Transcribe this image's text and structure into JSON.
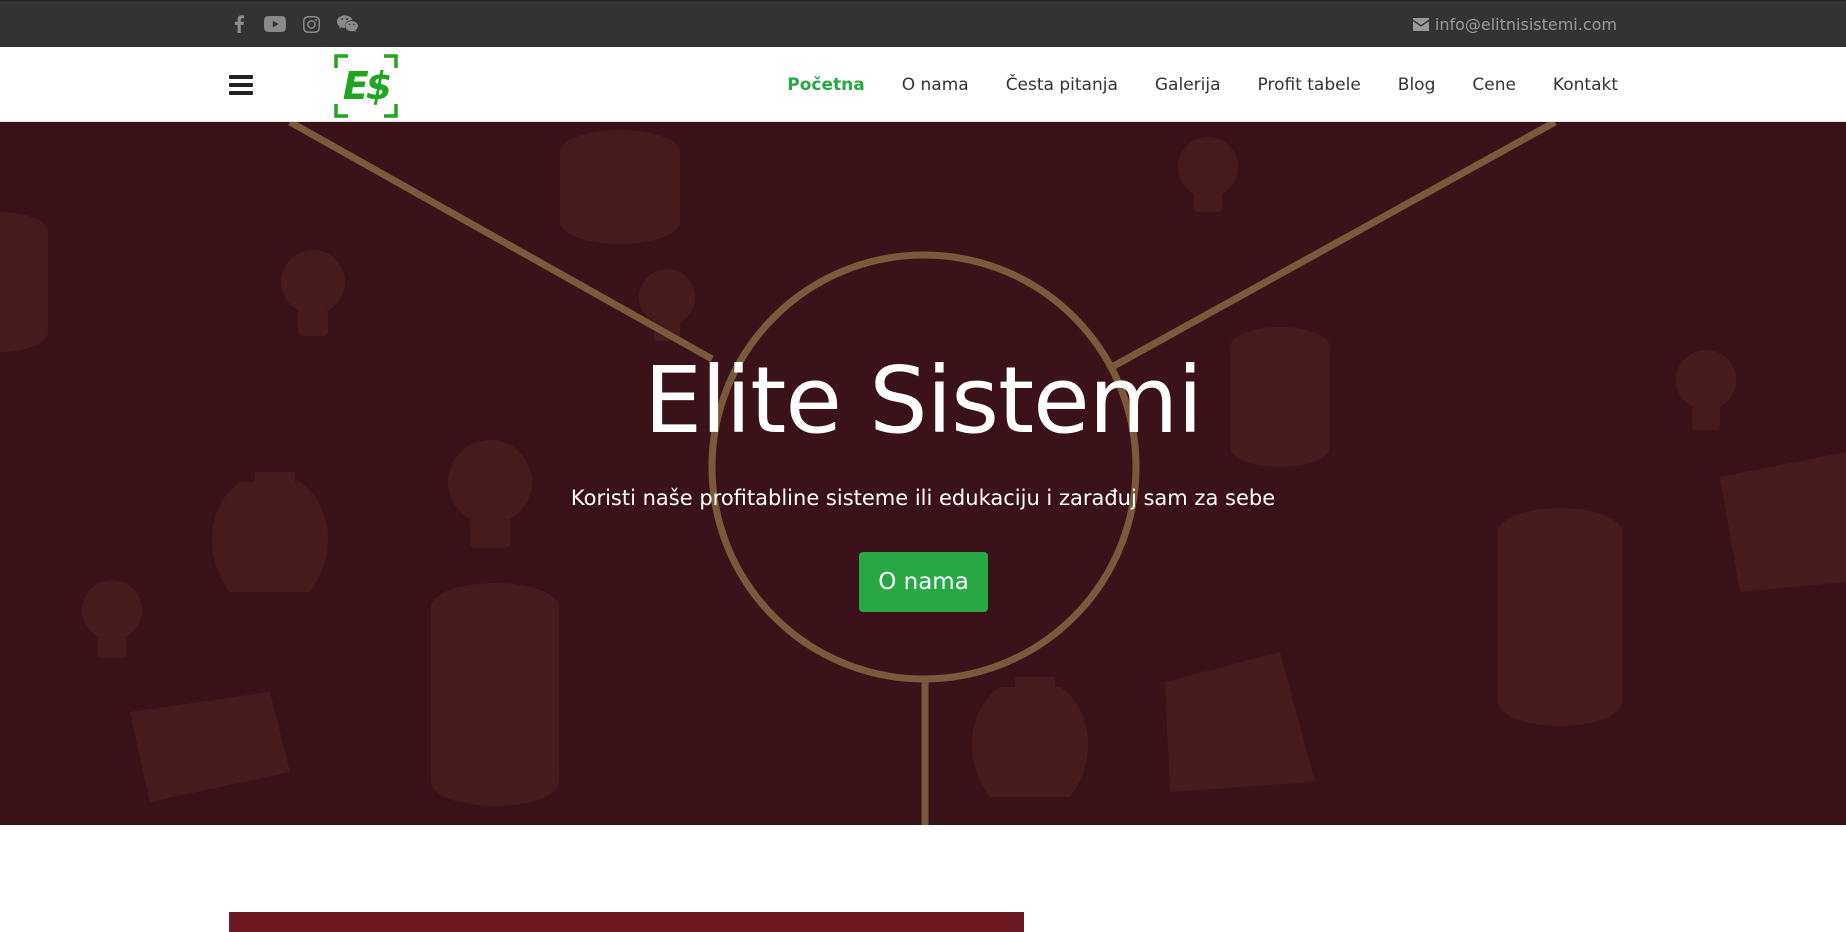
{
  "topbar": {
    "social": [
      {
        "icon": "facebook-icon"
      },
      {
        "icon": "youtube-icon"
      },
      {
        "icon": "instagram-icon"
      },
      {
        "icon": "wechat-icon"
      }
    ],
    "email": "info@elitnisistemi.com",
    "email_icon": "envelope-icon",
    "background": "#333333"
  },
  "navbar": {
    "logo_text": "E$",
    "logo_color": "#21a51f",
    "links": [
      {
        "label": "Početna",
        "active": true
      },
      {
        "label": "O nama"
      },
      {
        "label": "Česta pitanja"
      },
      {
        "label": "Galerija"
      },
      {
        "label": "Profit tabele"
      },
      {
        "label": "Blog"
      },
      {
        "label": "Cene"
      },
      {
        "label": "Kontakt"
      }
    ],
    "active_color": "#28a745"
  },
  "hero": {
    "title": "Elite Sistemi",
    "subtitle": "Koristi naše profitabline sisteme ili edukaciju i zarađuj sam za sebe",
    "button_label": "O nama",
    "background": "#3b1219",
    "accent": "#7a5a3a",
    "button_color": "#28a745"
  }
}
